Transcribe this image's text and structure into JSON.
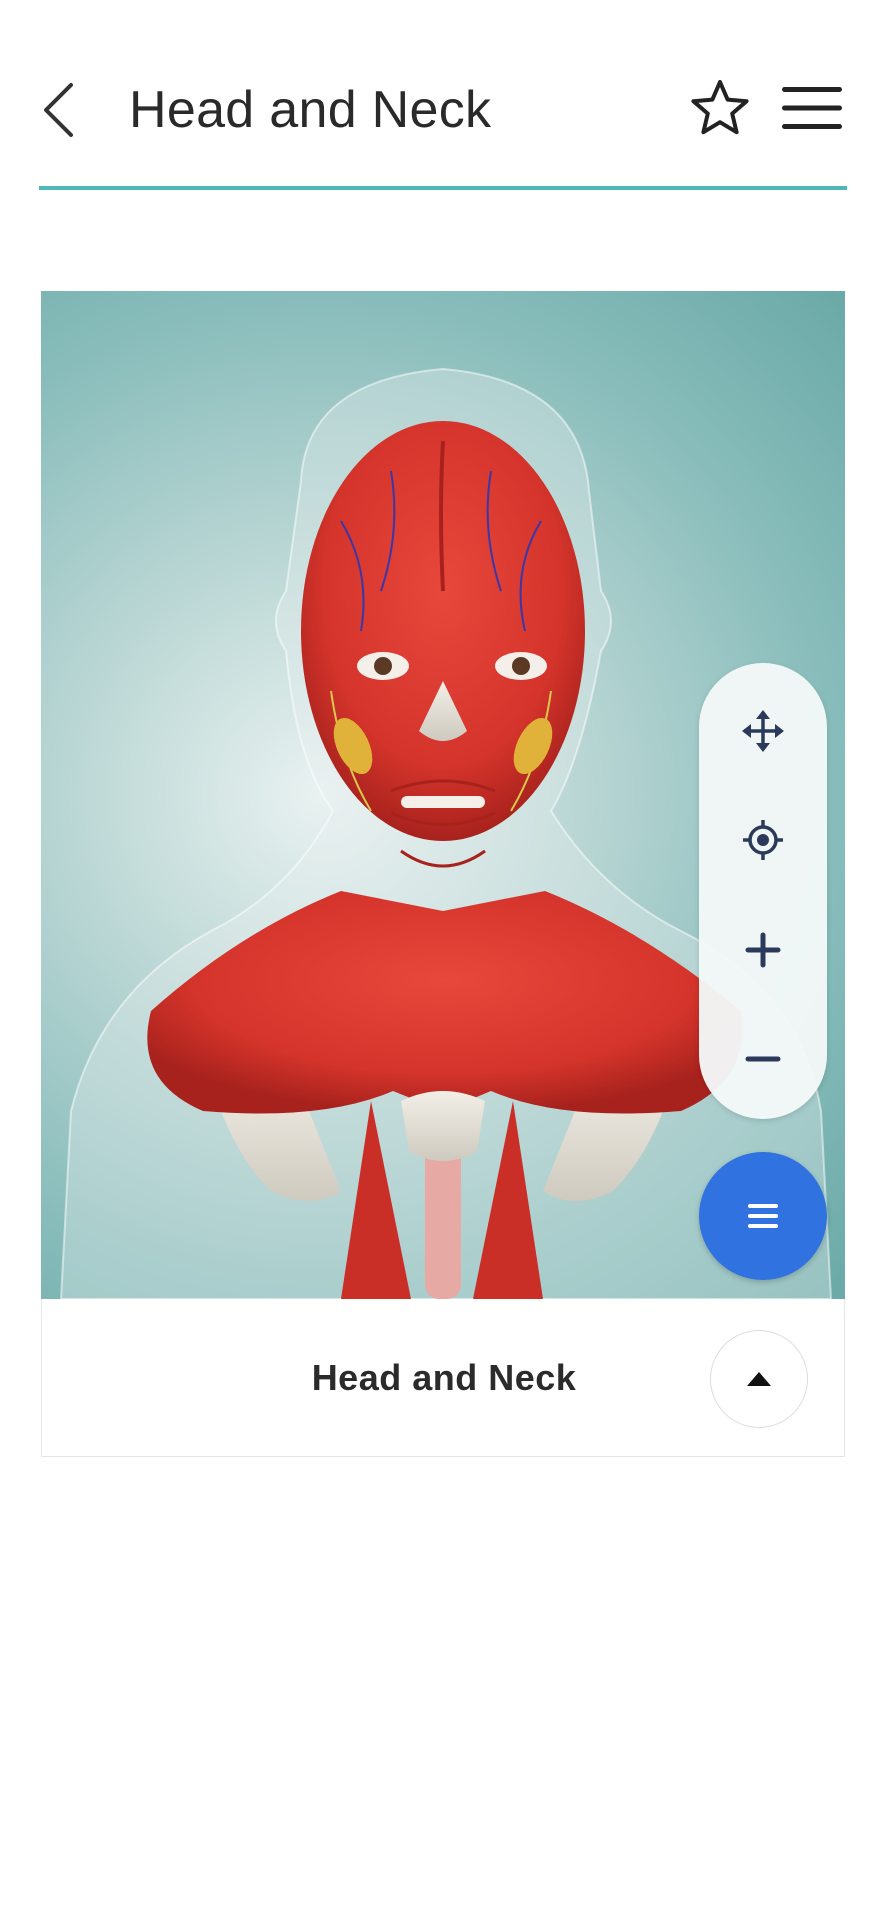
{
  "header": {
    "title": "Head and Neck",
    "back_icon": "chevron-left-icon",
    "favorite_icon": "star-outline-icon",
    "menu_icon": "hamburger-menu-icon",
    "accent_color": "#4fb8b5"
  },
  "viewer": {
    "model_description_icon": "3d-anatomy-model",
    "controls": [
      {
        "icon": "move-arrows-icon"
      },
      {
        "icon": "target-icon"
      },
      {
        "icon": "plus-icon"
      },
      {
        "icon": "minus-icon"
      }
    ],
    "fab_icon": "list-menu-icon",
    "fab_color": "#2f72e0",
    "logo_icon": "brand-logo"
  },
  "caption": {
    "title": "Head and Neck",
    "expand_icon": "caret-up-icon"
  }
}
